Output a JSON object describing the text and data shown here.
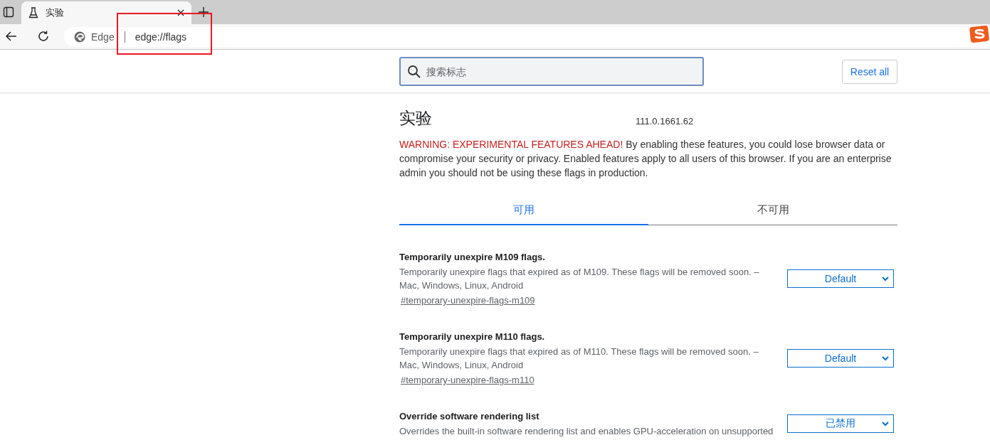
{
  "browser": {
    "tabs": [
      {
        "title": "实验",
        "selected": true
      }
    ],
    "address": {
      "site_label": "Edge",
      "url": "edge://flags"
    }
  },
  "annotations": [
    {
      "kind": "rectangle",
      "color": "#e8191f"
    }
  ],
  "search": {
    "placeholder": "搜索标志"
  },
  "reset_button": "Reset all",
  "title": "实验",
  "version": "111.0.1661.62",
  "warning": {
    "label": "WARNING: EXPERIMENTAL FEATURES AHEAD!",
    "text": "By enabling these features, you could lose browser data or compromise your security or privacy. Enabled features apply to all users of this browser. If you are an enterprise admin you should not be using these flags in production."
  },
  "tabs": [
    {
      "label": "可用",
      "selected": true
    },
    {
      "label": "不可用",
      "selected": false
    }
  ],
  "flags": [
    {
      "name": "Temporarily unexpire M109 flags.",
      "description": "Temporarily unexpire flags that expired as of M109. These flags will be removed soon. – Mac, Windows, Linux, Android",
      "link": "#temporary-unexpire-flags-m109",
      "value": "Default"
    },
    {
      "name": "Temporarily unexpire M110 flags.",
      "description": "Temporarily unexpire flags that expired as of M110. These flags will be removed soon. – Mac, Windows, Linux, Android",
      "link": "#temporary-unexpire-flags-m110",
      "value": "Default"
    },
    {
      "name": "Override software rendering list",
      "description": "Overrides the built-in software rendering list and enables GPU-acceleration on unsupported",
      "value": "已禁用"
    }
  ]
}
